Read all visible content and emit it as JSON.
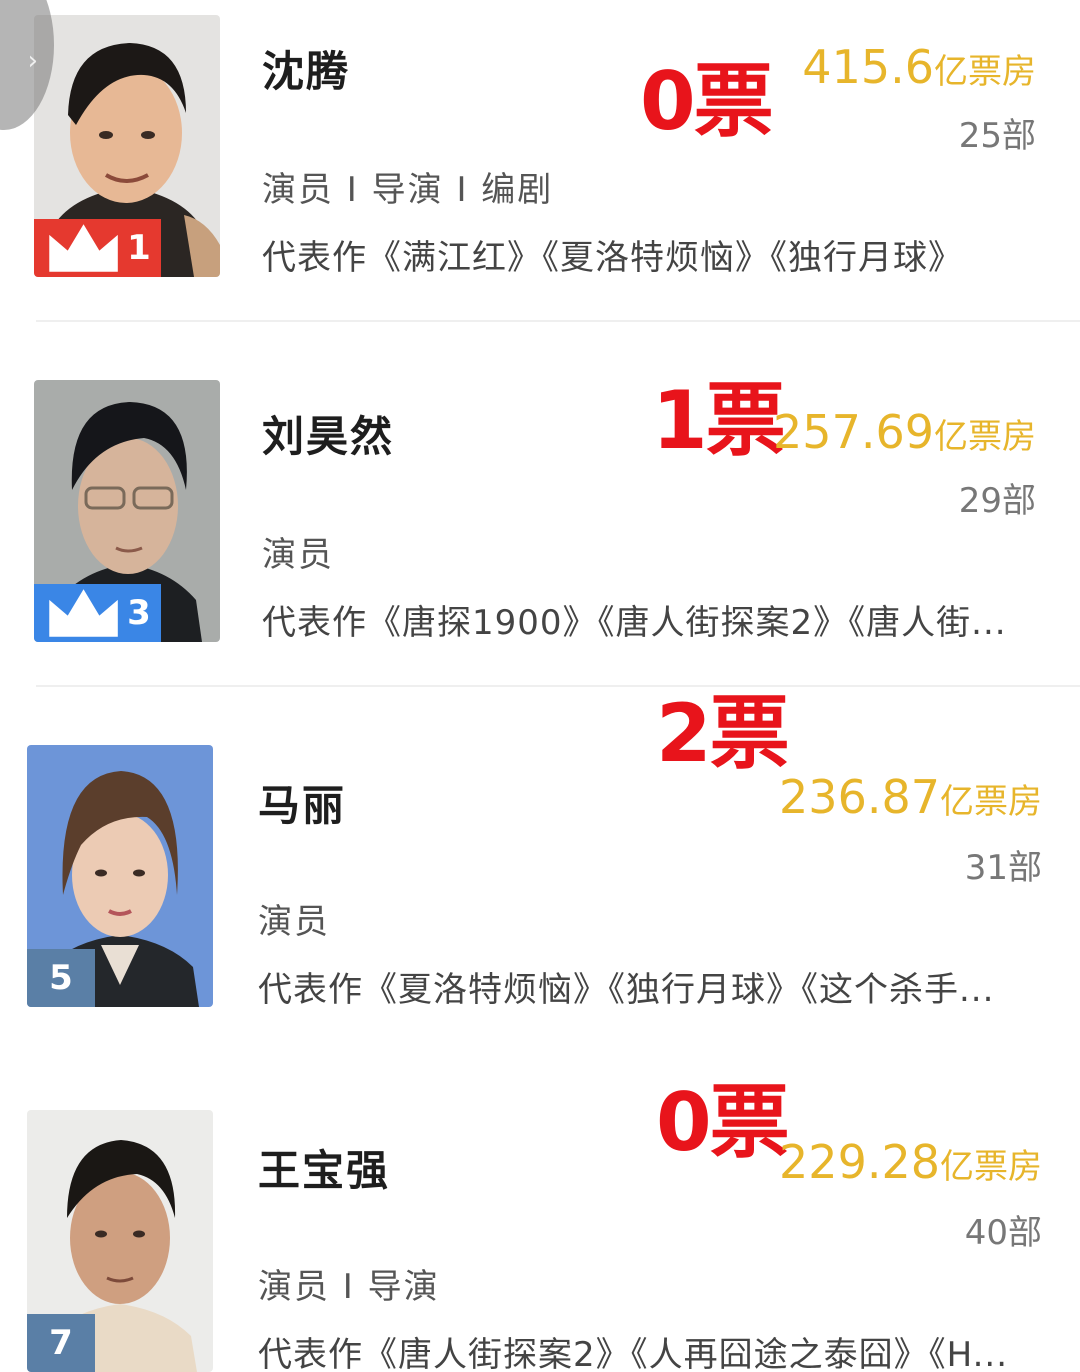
{
  "nav": {
    "back_icon": "chevron-right-icon"
  },
  "actors": [
    {
      "name": "沈腾",
      "roles": "演员 I 导演 I 编剧",
      "works": "代表作《满江红》《夏洛特烦恼》《独行月球》",
      "rank": "1",
      "rank_style": "crown-red",
      "votes": "0票",
      "box_office_value": "415.6",
      "box_office_unit": "亿票房",
      "film_count": "25部"
    },
    {
      "name": "刘昊然",
      "roles": "演员",
      "works": "代表作《唐探1900》《唐人街探案2》《唐人街...",
      "rank": "3",
      "rank_style": "crown-blue",
      "votes": "1票",
      "box_office_value": "257.69",
      "box_office_unit": "亿票房",
      "film_count": "29部"
    },
    {
      "name": "马丽",
      "roles": "演员",
      "works": "代表作《夏洛特烦恼》《独行月球》《这个杀手...",
      "rank": "5",
      "rank_style": "plain",
      "votes": "2票",
      "box_office_value": "236.87",
      "box_office_unit": "亿票房",
      "film_count": "31部"
    },
    {
      "name": "王宝强",
      "roles": "演员 I 导演",
      "works": "代表作《唐人街探案2》《人再囧途之泰囧》《H...",
      "rank": "7",
      "rank_style": "plain",
      "votes": "0票",
      "box_office_value": "229.28",
      "box_office_unit": "亿票房",
      "film_count": "40部"
    }
  ],
  "colors": {
    "votes": "#e8141b",
    "box_office": "#e7b52b",
    "rank_gold": "#e5392f",
    "rank_blue": "#3a86e6",
    "rank_plain": "#5a7fa6"
  }
}
